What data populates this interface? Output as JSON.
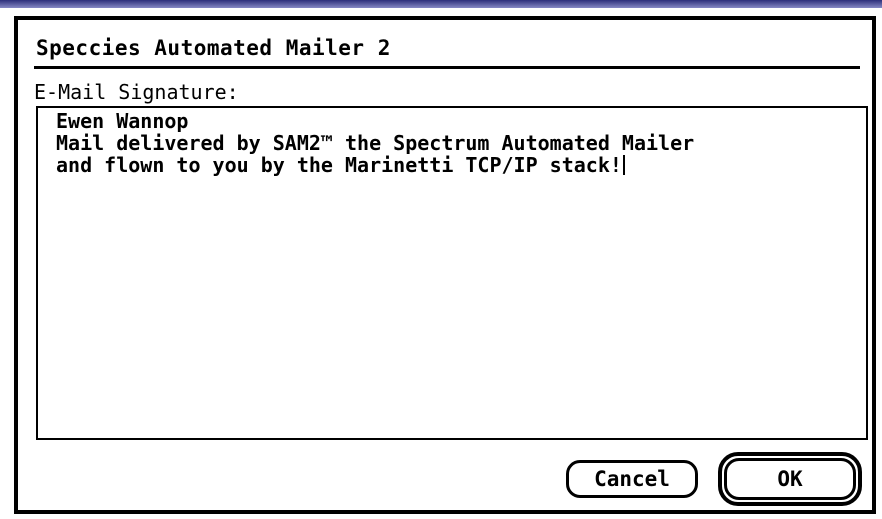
{
  "dialog": {
    "title": "Speccies Automated Mailer 2",
    "field_label": "E-Mail Signature:",
    "signature_lines": [
      "Ewen Wannop",
      "Mail delivered by SAM2™ the Spectrum Automated Mailer",
      "and flown to you by the Marinetti TCP/IP stack!"
    ]
  },
  "buttons": {
    "cancel_label": "Cancel",
    "ok_label": "OK"
  }
}
